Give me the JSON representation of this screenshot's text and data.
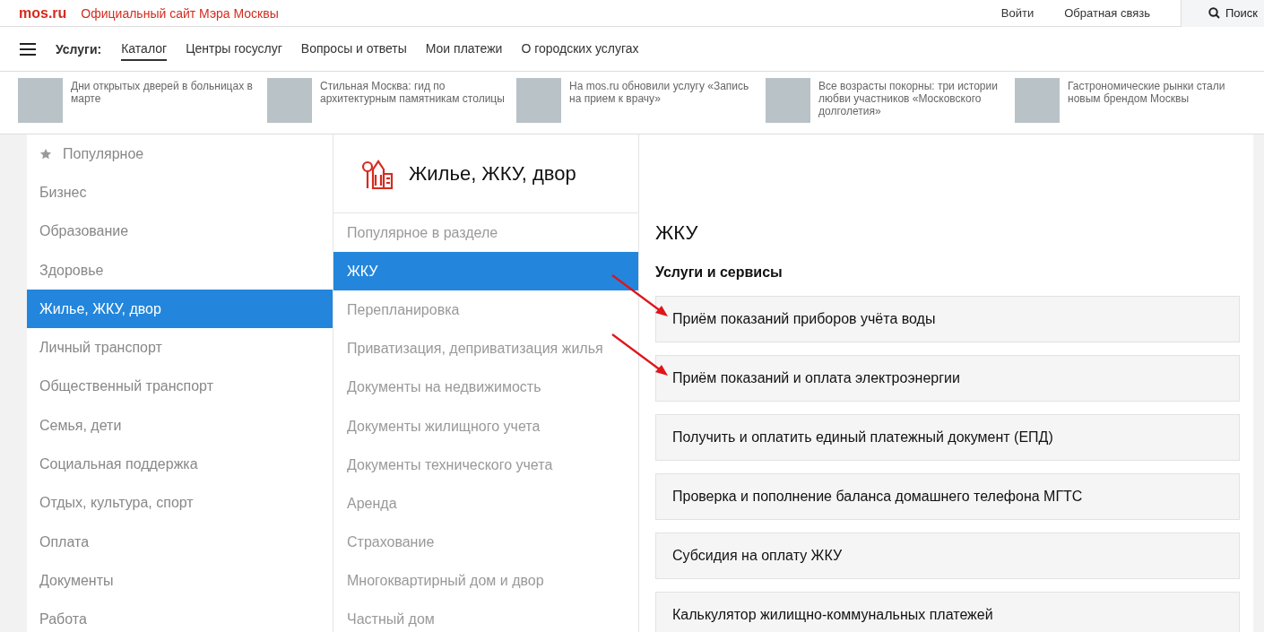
{
  "top_bar": {
    "logo": "mos.ru",
    "site_title": "Официальный сайт Мэра Москвы",
    "login": "Войти",
    "feedback": "Обратная связь",
    "search": "Поиск"
  },
  "nav": {
    "label": "Услуги:",
    "tabs": [
      {
        "label": "Каталог",
        "selected": true
      },
      {
        "label": "Центры госуслуг",
        "selected": false
      },
      {
        "label": "Вопросы и ответы",
        "selected": false
      },
      {
        "label": "Мои платежи",
        "selected": false
      },
      {
        "label": "О городских услугах",
        "selected": false
      }
    ]
  },
  "news": [
    {
      "text": "Дни открытых дверей в больницах в марте"
    },
    {
      "text": "Стильная Москва: гид по архитектурным памятникам столицы"
    },
    {
      "text": "На mos.ru обновили услугу «Запись на прием к врачу»"
    },
    {
      "text": "Все возрасты покорны: три истории любви участников «Московского долголетия»"
    },
    {
      "text": "Гастрономические рынки стали новым брендом Москвы"
    }
  ],
  "sidebar": {
    "items": [
      {
        "label": "Популярное",
        "kind": "popular",
        "selected": false
      },
      {
        "label": "Бизнес",
        "kind": "plain",
        "selected": false
      },
      {
        "label": "Образование",
        "kind": "plain",
        "selected": false
      },
      {
        "label": "Здоровье",
        "kind": "plain",
        "selected": false
      },
      {
        "label": "Жилье, ЖКУ, двор",
        "kind": "plain",
        "selected": true
      },
      {
        "label": "Личный транспорт",
        "kind": "plain",
        "selected": false
      },
      {
        "label": "Общественный транспорт",
        "kind": "plain",
        "selected": false
      },
      {
        "label": "Семья, дети",
        "kind": "plain",
        "selected": false
      },
      {
        "label": "Социальная поддержка",
        "kind": "plain",
        "selected": false
      },
      {
        "label": "Отдых, культура, спорт",
        "kind": "plain",
        "selected": false
      },
      {
        "label": "Оплата",
        "kind": "plain",
        "selected": false
      },
      {
        "label": "Документы",
        "kind": "plain",
        "selected": false
      },
      {
        "label": "Работа",
        "kind": "plain",
        "selected": false
      }
    ]
  },
  "section": {
    "title": "Жилье, ЖКУ, двор",
    "items": [
      {
        "label": "Популярное в разделе",
        "selected": false
      },
      {
        "label": "ЖКУ",
        "selected": true
      },
      {
        "label": "Перепланировка",
        "selected": false
      },
      {
        "label": "Приватизация, деприватизация жилья",
        "selected": false
      },
      {
        "label": "Документы на недвижимость",
        "selected": false
      },
      {
        "label": "Документы жилищного учета",
        "selected": false
      },
      {
        "label": "Документы технического учета",
        "selected": false
      },
      {
        "label": "Аренда",
        "selected": false
      },
      {
        "label": "Страхование",
        "selected": false
      },
      {
        "label": "Многоквартирный дом и двор",
        "selected": false
      },
      {
        "label": "Частный дом",
        "selected": false
      }
    ]
  },
  "content": {
    "title": "ЖКУ",
    "subtitle": "Услуги и сервисы",
    "services": [
      {
        "label": "Приём показаний приборов учёта воды",
        "arrow": true
      },
      {
        "label": "Приём показаний и оплата электроэнергии",
        "arrow": true
      },
      {
        "label": "Получить и оплатить единый платежный документ (ЕПД)",
        "arrow": false
      },
      {
        "label": "Проверка и пополнение баланса домашнего телефона МГТС",
        "arrow": false
      },
      {
        "label": "Субсидия на оплату ЖКУ",
        "arrow": false
      },
      {
        "label": "Калькулятор жилищно-коммунальных платежей",
        "arrow": false
      }
    ]
  }
}
